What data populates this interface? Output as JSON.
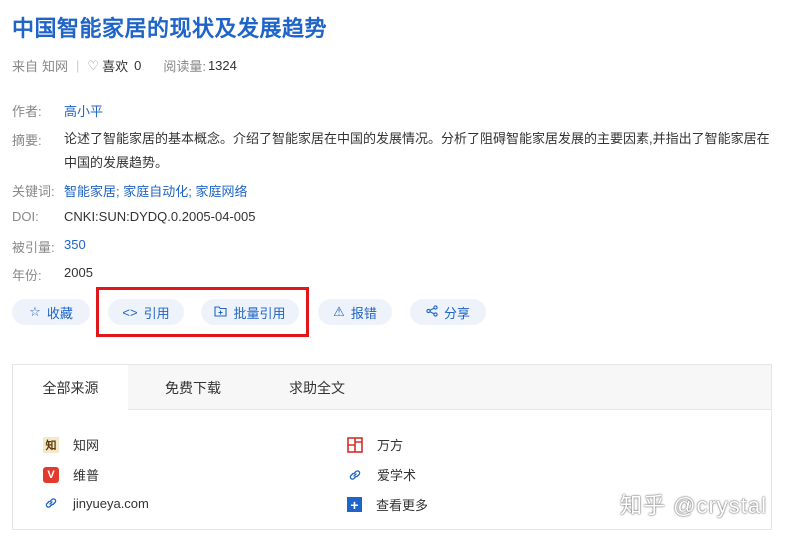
{
  "title": "中国智能家居的现状及发展趋势",
  "meta": {
    "source_prefix": "来自",
    "source": "知网",
    "separator": "|",
    "like_label": "喜欢",
    "like_count": "0",
    "reads_label": "阅读量:",
    "reads_count": "1324"
  },
  "fields": {
    "author_label": "作者:",
    "author": "高小平",
    "abstract_label": "摘要:",
    "abstract": "论述了智能家居的基本概念。介绍了智能家居在中国的发展情况。分析了阻碍智能家居发展的主要因素,并指出了智能家居在中国的发展趋势。",
    "keywords_label": "关键词:",
    "keywords": [
      "智能家居",
      "家庭自动化",
      "家庭网络"
    ],
    "keyword_sep": ";",
    "doi_label": "DOI:",
    "doi": "CNKI:SUN:DYDQ.0.2005-04-005",
    "cited_label": "被引量:",
    "cited": "350",
    "year_label": "年份:",
    "year": "2005"
  },
  "actions": {
    "collect": "收藏",
    "cite": "引用",
    "batch_cite": "批量引用",
    "report": "报错",
    "share": "分享"
  },
  "tabs": [
    "全部来源",
    "免费下载",
    "求助全文"
  ],
  "sources": {
    "left": [
      {
        "name": "知网",
        "icon": "cnki-logo-icon"
      },
      {
        "name": "维普",
        "icon": "vip-logo-icon"
      },
      {
        "name": "jinyueya.com",
        "icon": "link-icon"
      }
    ],
    "right": [
      {
        "name": "万方",
        "icon": "wanfang-logo-icon"
      },
      {
        "name": "爱学术",
        "icon": "link-icon"
      },
      {
        "name": "查看更多",
        "icon": "plus-icon"
      }
    ]
  },
  "watermark": "知乎 @crystal",
  "colors": {
    "link": "#1f64c8",
    "highlight": "#e0161b",
    "button_bg": "#eef3fb"
  }
}
